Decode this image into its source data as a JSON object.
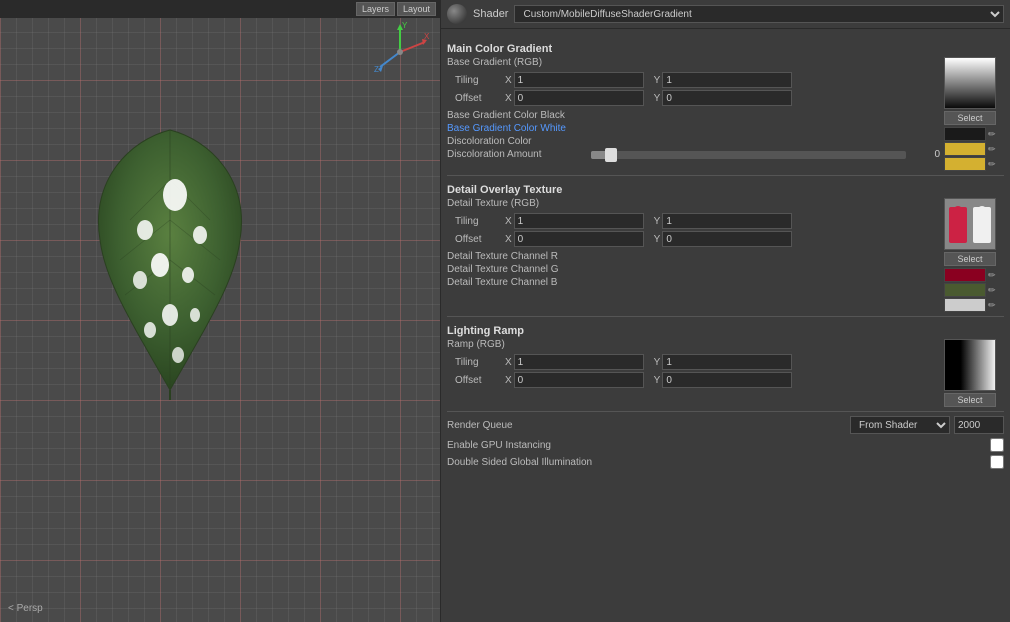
{
  "viewport": {
    "persp_label": "< Persp",
    "corner_buttons": [
      "Layers",
      "Layout"
    ]
  },
  "shader": {
    "label": "Shader",
    "value": "Custom/MobileDiffuseShaderGradient"
  },
  "main_color_gradient": {
    "section_title": "Main Color Gradient",
    "base_gradient_rgb": "Base Gradient (RGB)",
    "tiling_label": "Tiling",
    "offset_label": "Offset",
    "tiling_x": "1",
    "tiling_y": "1",
    "offset_x": "0",
    "offset_y": "0",
    "base_gradient_black": "Base Gradient Color Black",
    "base_gradient_white": "Base Gradient Color White",
    "discoloration_color": "Discoloration Color",
    "discoloration_amount": "Discoloration Amount",
    "discoloration_value": "0",
    "select_label": "Select"
  },
  "detail_overlay": {
    "section_title": "Detail Overlay Texture",
    "detail_texture_rgb": "Detail Texture (RGB)",
    "tiling_label": "Tiling",
    "offset_label": "Offset",
    "tiling_x": "1",
    "tiling_y": "1",
    "offset_x": "0",
    "offset_y": "0",
    "channel_r": "Detail Texture Channel R",
    "channel_g": "Detail Texture Channel G",
    "channel_b": "Detail Texture Channel B",
    "select_label": "Select"
  },
  "lighting_ramp": {
    "section_title": "Lighting Ramp",
    "ramp_rgb": "Ramp (RGB)",
    "tiling_label": "Tiling",
    "offset_label": "Offset",
    "tiling_x": "1",
    "tiling_y": "1",
    "offset_x": "0",
    "offset_y": "0",
    "select_label": "Select"
  },
  "render_settings": {
    "render_queue_label": "Render Queue",
    "render_queue_option": "From Shader",
    "render_queue_value": "2000",
    "gpu_instancing_label": "Enable GPU Instancing",
    "double_sided_label": "Double Sided Global Illumination"
  },
  "swatches": {
    "gradient_black_color": "#1a1a1a",
    "gradient_white_color": "#ffffff",
    "discoloration_color": "#d4b830",
    "detail_r_color": "#8a0020",
    "detail_g_color": "#4a5a30",
    "detail_b_color": "#cccccc"
  }
}
